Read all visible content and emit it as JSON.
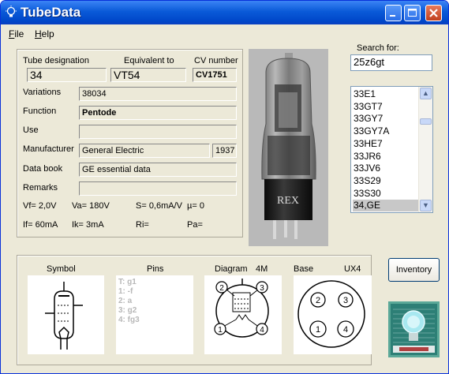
{
  "window": {
    "title": "TubeData"
  },
  "menu": {
    "file": "File",
    "help": "Help"
  },
  "details": {
    "tube_designation_label": "Tube designation",
    "equivalent_label": "Equivalent to",
    "cv_label": "CV number",
    "tube_designation": "34",
    "equivalent": "VT54",
    "cv_number": "CV1751",
    "variations_label": "Variations",
    "variations": "38034",
    "function_label": "Function",
    "function": "Pentode",
    "use_label": "Use",
    "use": "",
    "manufacturer_label": "Manufacturer",
    "manufacturer": "General Electric",
    "year": "1937",
    "databook_label": "Data book",
    "databook": "GE essential data",
    "remarks_label": "Remarks",
    "remarks": "",
    "vf": "Vf= 2,0V",
    "va": "Va= 180V",
    "s": "S= 0,6mA/V",
    "mu": "µ=    0",
    "if": "If= 60mA",
    "ik": "Ik=   3mA",
    "ri": "Ri=",
    "pa": "Pa="
  },
  "photo": {
    "brand": "REX"
  },
  "search": {
    "label": "Search for:",
    "value": "25z6gt",
    "list": [
      "33E1",
      "33GT7",
      "33GY7",
      "33GY7A",
      "33HE7",
      "33JR6",
      "33JV6",
      "33S29",
      "33S30",
      "34,GE"
    ],
    "selected_index": 9
  },
  "bottom": {
    "symbol_label": "Symbol",
    "pins_label": "Pins",
    "diagram_label": "Diagram",
    "diagram_code": "4M",
    "base_label": "Base",
    "base_code": "UX4",
    "pins": [
      "T: g1",
      "1: -f",
      "2: a",
      "3: g2",
      "4: fg3"
    ],
    "pin_numbers": [
      "1",
      "2",
      "3",
      "4"
    ]
  },
  "buttons": {
    "inventory": "Inventory"
  },
  "colors": {
    "titlebar": "#0a5ad8",
    "window_bg": "#ece9d8",
    "list_select": "#c8c8c8"
  }
}
